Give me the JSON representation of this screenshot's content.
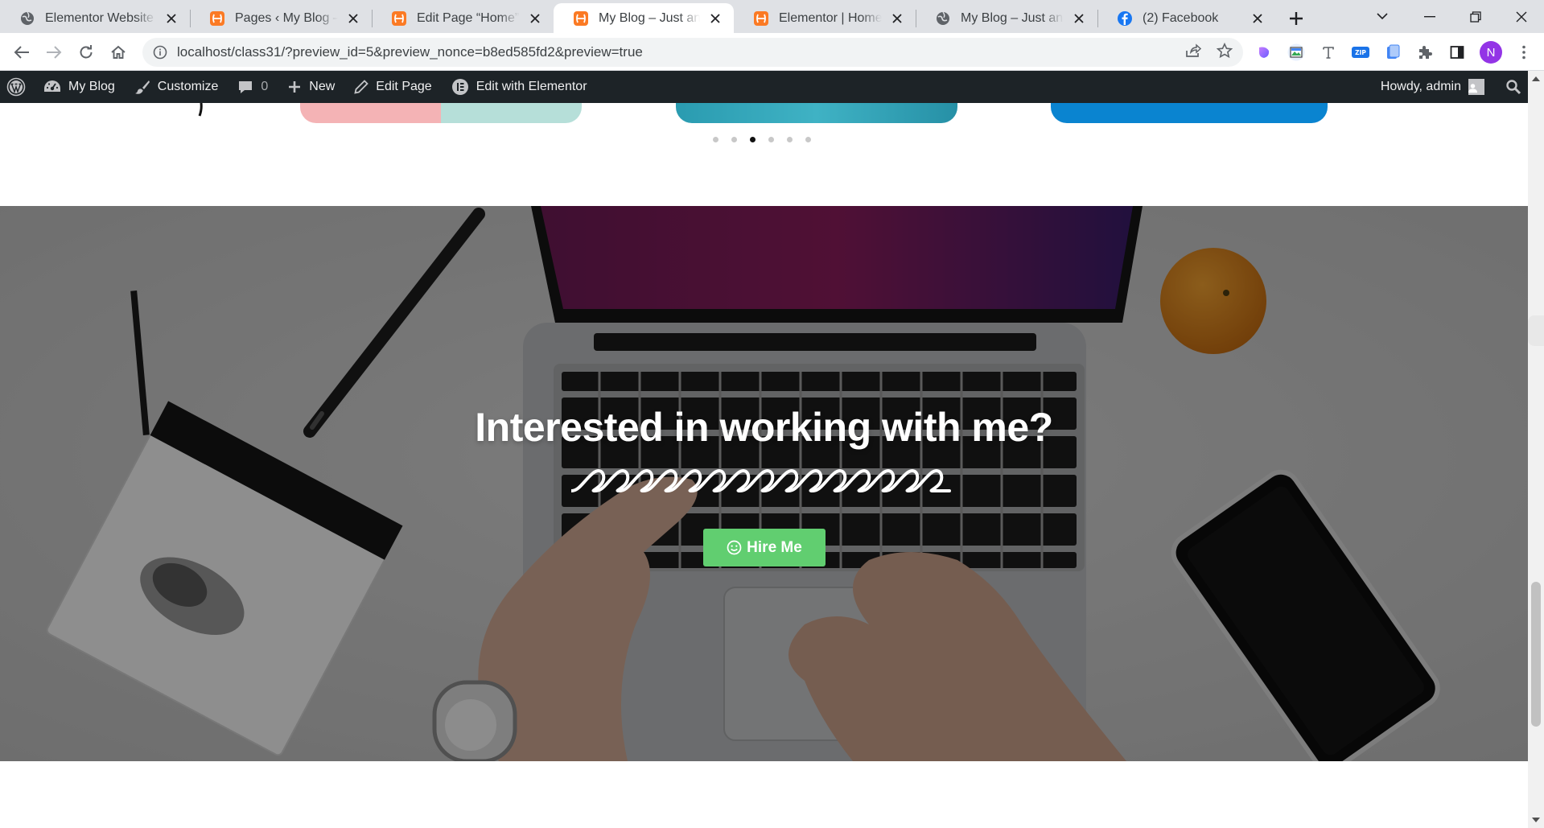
{
  "browser": {
    "tabs": [
      {
        "title": "Elementor Website Bu",
        "favicon": "globe-icon",
        "active": false
      },
      {
        "title": "Pages ‹ My Blog — W",
        "favicon": "xampp-icon",
        "active": false
      },
      {
        "title": "Edit Page “Home” ‹ M",
        "favicon": "xampp-icon",
        "active": false
      },
      {
        "title": "My Blog – Just anothe",
        "favicon": "xampp-icon",
        "active": true
      },
      {
        "title": "Elementor | Home",
        "favicon": "xampp-icon",
        "active": false
      },
      {
        "title": "My Blog – Just anothe",
        "favicon": "globe-icon",
        "active": false
      },
      {
        "title": "(2) Facebook",
        "favicon": "facebook-icon",
        "active": false
      }
    ],
    "url": "localhost/class31/?preview_id=5&preview_nonce=b8ed585fd2&preview=true",
    "profile_initial": "N",
    "colors": {
      "tabstrip": "#dfe1e5",
      "profile": "#9334e6"
    }
  },
  "adminbar": {
    "site_name": "My Blog",
    "customize": "Customize",
    "comments_count": "0",
    "new_label": "New",
    "edit_page": "Edit Page",
    "edit_elementor": "Edit with Elementor",
    "howdy": "Howdy, admin"
  },
  "page": {
    "carousel": {
      "slide_count": 6,
      "active_index": 2
    },
    "cta": {
      "title": "Interested in working with me?",
      "button_label": "Hire Me",
      "button_color": "#61ce70"
    }
  }
}
